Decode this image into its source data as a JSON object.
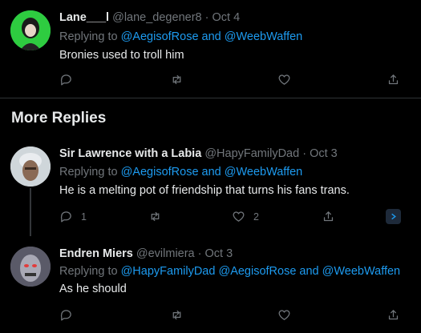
{
  "tweets": [
    {
      "name": "Lane___l",
      "handle": "@lane_degener8",
      "sep": "·",
      "date": "Oct 4",
      "replying_prefix": "Replying to",
      "mentions": "@AegisofRose and @WeebWaffen",
      "text": "Bronies used to troll him",
      "reply_count": "",
      "like_count": ""
    },
    {
      "name": "Sir Lawrence with a Labia",
      "handle": "@HapyFamilyDad",
      "sep": "·",
      "date": "Oct 3",
      "replying_prefix": "Replying to",
      "mentions": "@AegisofRose and @WeebWaffen",
      "text": "He is a melting pot of friendship that turns his fans trans.",
      "reply_count": "1",
      "like_count": "2"
    },
    {
      "name": "Endren Miers",
      "handle": "@evilmiera",
      "sep": "·",
      "date": "Oct 3",
      "replying_prefix": "Replying to",
      "mentions": "@HapyFamilyDad @AegisofRose and @WeebWaffen",
      "text": "As he should",
      "reply_count": "",
      "like_count": ""
    }
  ],
  "section": {
    "title": "More Replies"
  },
  "icons": {
    "reply": "reply-icon",
    "retweet": "retweet-icon",
    "like": "heart-icon",
    "share": "share-icon",
    "analytics": "promote-icon"
  },
  "colors": {
    "link": "#1d9bf0",
    "muted": "#71767b",
    "background": "#000000"
  }
}
